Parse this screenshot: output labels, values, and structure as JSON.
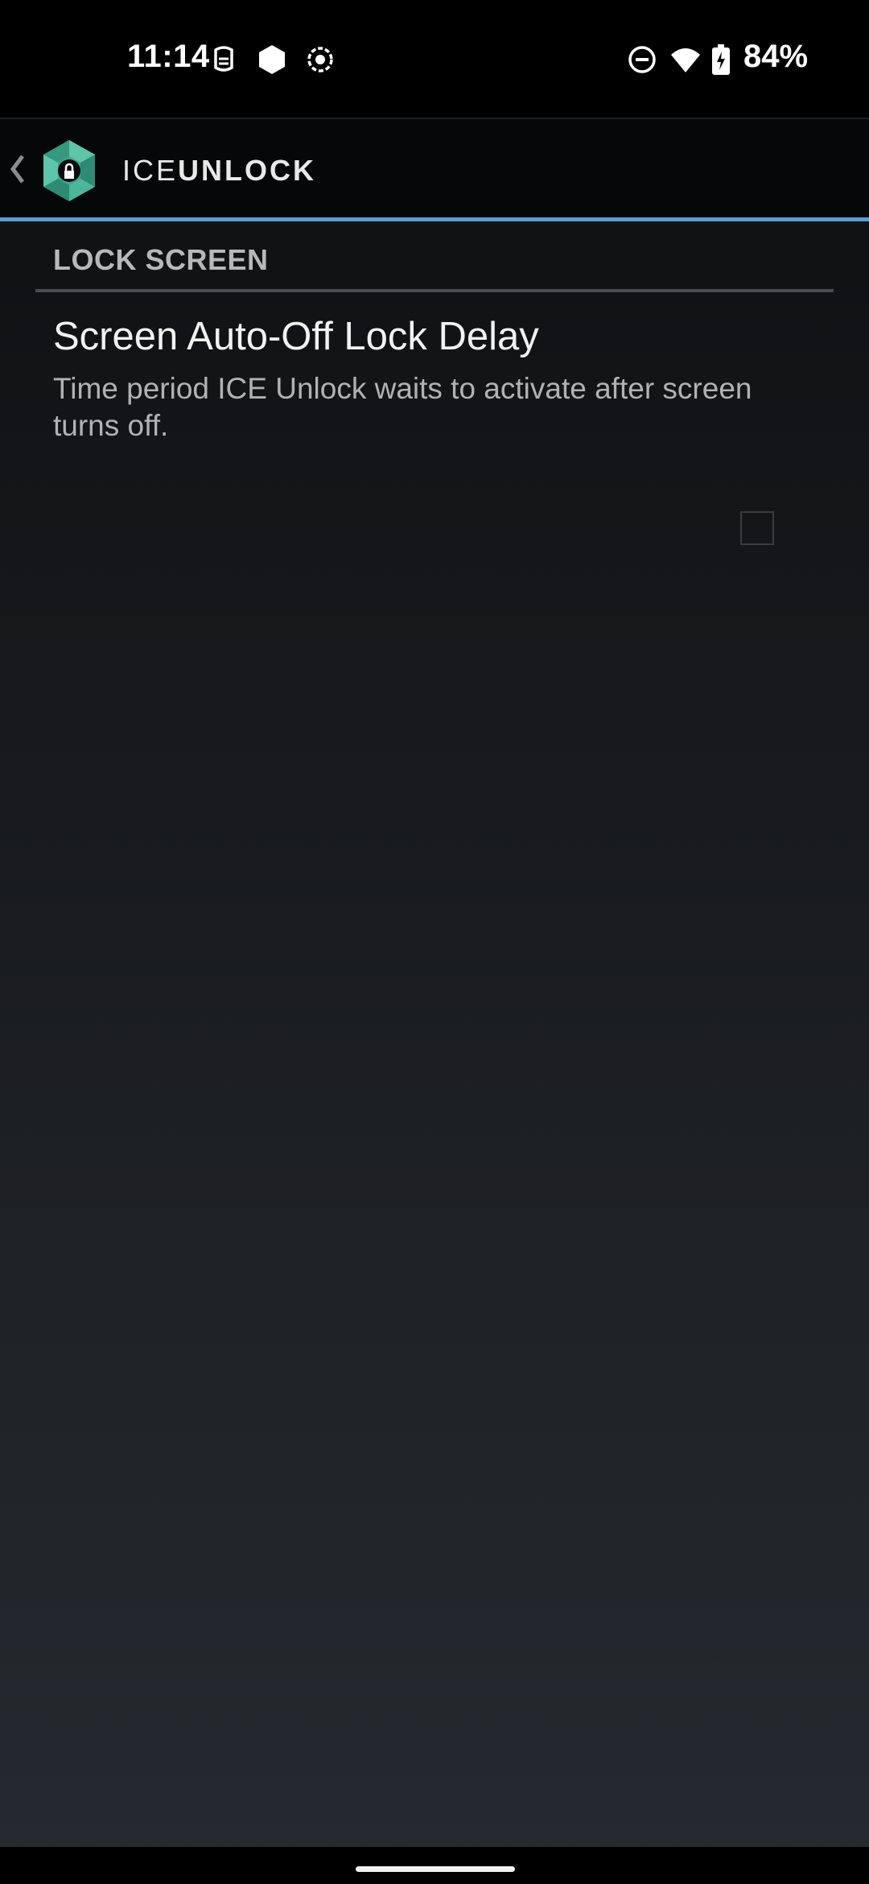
{
  "status_bar": {
    "time": "11:14",
    "battery_percent": "84%",
    "icons": [
      "mascot-icon",
      "hexagon-icon",
      "record-icon",
      "do-not-disturb-icon",
      "wifi-icon",
      "battery-charging-icon"
    ]
  },
  "toolbar": {
    "title_light": "ICE",
    "title_bold": "UNLOCK",
    "accent_color": "#5b9fd0",
    "logo_color": "#3fa88f"
  },
  "section": {
    "header": "LOCK SCREEN"
  },
  "preference": {
    "title": "Screen Auto-Off Lock Delay",
    "summary": "Time period ICE Unlock waits to activate after screen turns off."
  }
}
